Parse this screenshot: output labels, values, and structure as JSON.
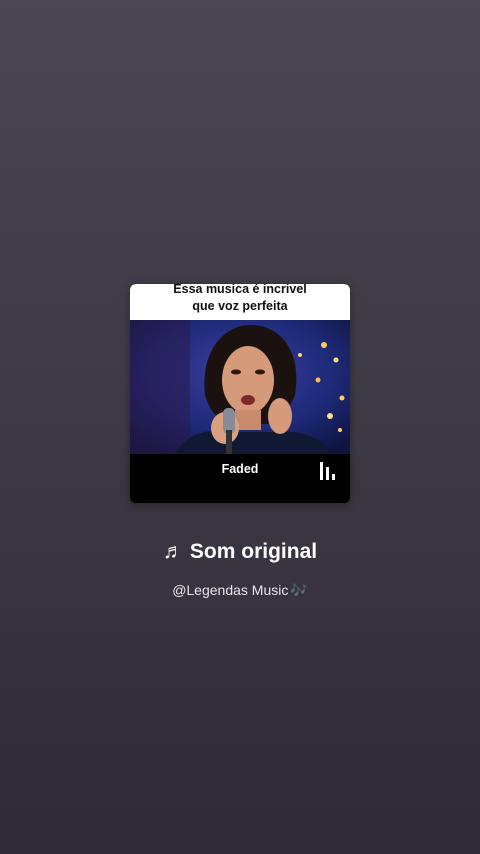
{
  "card": {
    "caption_line1": "Essa musica é incrivel",
    "caption_line2": "que voz perfeita",
    "track_name": "Faded",
    "playback_icon": "pause-icon"
  },
  "sound": {
    "note_icon": "♬",
    "title": "Som original",
    "author": "@Legendas Music",
    "author_emoji": "🎶"
  }
}
